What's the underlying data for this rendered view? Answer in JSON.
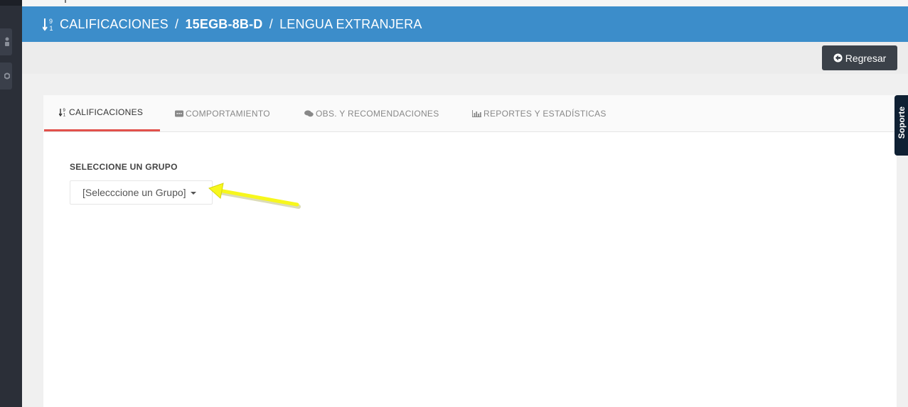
{
  "header": {
    "icon": "sort-numeric-icon",
    "title_part1": "CALIFICACIONES",
    "separator1": "/",
    "title_part2": "15EGB-8B-D",
    "separator2": "/",
    "title_part3": "LENGUA EXTRANJERA",
    "background": "#3c8dca"
  },
  "toolbar": {
    "back_label": "Regresar",
    "back_icon": "arrow-circle-left-icon"
  },
  "tabs": [
    {
      "label": "CALIFICACIONES",
      "icon": "sort-numeric-icon",
      "active": true
    },
    {
      "label": "COMPORTAMIENTO",
      "icon": "comment-dots-icon",
      "active": false
    },
    {
      "label": "OBS. Y RECOMENDACIONES",
      "icon": "comments-icon",
      "active": false
    },
    {
      "label": "REPORTES Y ESTADÍSTICAS",
      "icon": "bar-chart-icon",
      "active": false
    }
  ],
  "content": {
    "section_label": "SELECCIONE UN GRUPO",
    "group_select_value": "[Selecccione un Grupo]"
  },
  "side_tab": {
    "label": "Soporte"
  },
  "colors": {
    "active_tab_border": "#e2514b",
    "annotation_arrow": "#f7f71c"
  }
}
